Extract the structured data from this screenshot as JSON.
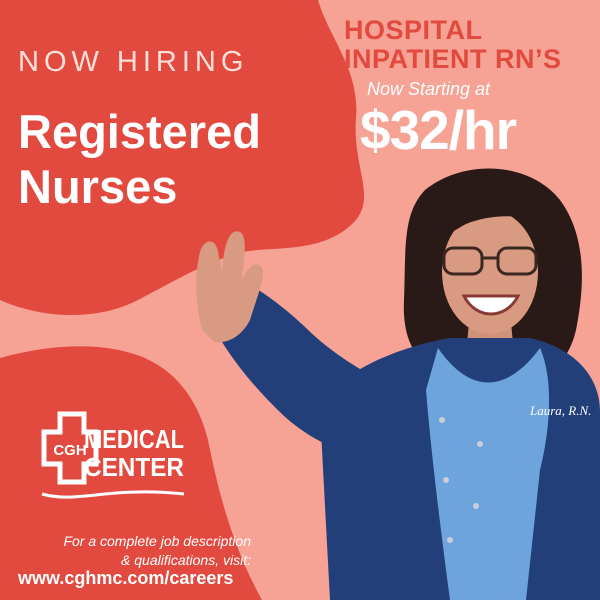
{
  "ad": {
    "eyebrow": "NOW HIRING",
    "headline_line1": "Registered",
    "headline_line2": "Nurses",
    "position_line1": "HOSPITAL",
    "position_line2": "INPATIENT RN’S",
    "starting_text": "Now Starting at",
    "wage": "$32/hr",
    "footer_line1": "For a complete job description",
    "footer_line2": "& qualifications, visit:",
    "url": "www.cghmc.com/careers"
  },
  "logo": {
    "emblem_text": "CGH",
    "line1": "MEDICAL",
    "line2": "CENTER"
  },
  "photo": {
    "name_tag": "Laura, R.N."
  },
  "colors": {
    "dark_red": "#e24a3f",
    "salmon": "#f6a295",
    "navy_scrubs": "#223f7a",
    "light_blue": "#6ea4dc"
  }
}
